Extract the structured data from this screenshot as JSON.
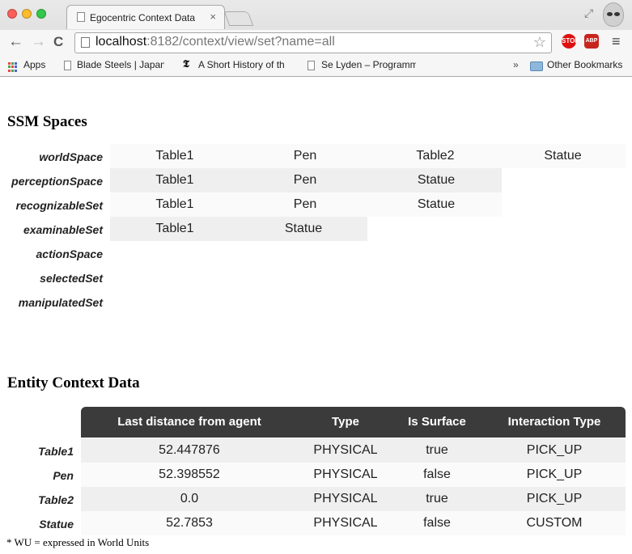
{
  "browser": {
    "tab_title": "Egocentric Context Data",
    "tab_close": "×",
    "url_host": "localhost",
    "url_rest": ":8182/context/view/set?name=all",
    "back": "←",
    "forward": "→",
    "reload": "C",
    "star": "☆",
    "ext_stop_label": "STOP",
    "ext_abp_label": "ABP",
    "menu": "≡",
    "expand": "⤢",
    "bookmarks": {
      "apps": "Apps",
      "items": [
        "Blade Steels | Japan",
        "A Short History of th",
        "Se Lyden – Programm"
      ],
      "overflow": "»",
      "other": "Other Bookmarks"
    }
  },
  "ssm": {
    "title": "SSM Spaces",
    "rows": [
      {
        "label": "worldSpace",
        "cells": [
          "Table1",
          "Pen",
          "Table2",
          "Statue"
        ]
      },
      {
        "label": "perceptionSpace",
        "cells": [
          "Table1",
          "Pen",
          "Statue"
        ]
      },
      {
        "label": "recognizableSet",
        "cells": [
          "Table1",
          "Pen",
          "Statue"
        ]
      },
      {
        "label": "examinableSet",
        "cells": [
          "Table1",
          "Statue"
        ]
      },
      {
        "label": "actionSpace",
        "cells": []
      },
      {
        "label": "selectedSet",
        "cells": []
      },
      {
        "label": "manipulatedSet",
        "cells": []
      }
    ]
  },
  "entity": {
    "title": "Entity Context Data",
    "headers": [
      "Last distance from agent",
      "Type",
      "Is Surface",
      "Interaction Type"
    ],
    "rows": [
      {
        "label": "Table1",
        "distance": "52.447876",
        "type": "PHYSICAL",
        "surface": "true",
        "interaction": "PICK_UP"
      },
      {
        "label": "Pen",
        "distance": "52.398552",
        "type": "PHYSICAL",
        "surface": "false",
        "interaction": "PICK_UP"
      },
      {
        "label": "Table2",
        "distance": "0.0",
        "type": "PHYSICAL",
        "surface": "true",
        "interaction": "PICK_UP"
      },
      {
        "label": "Statue",
        "distance": "52.7853",
        "type": "PHYSICAL",
        "surface": "false",
        "interaction": "CUSTOM"
      }
    ],
    "footnote": "* WU = expressed in World Units"
  }
}
